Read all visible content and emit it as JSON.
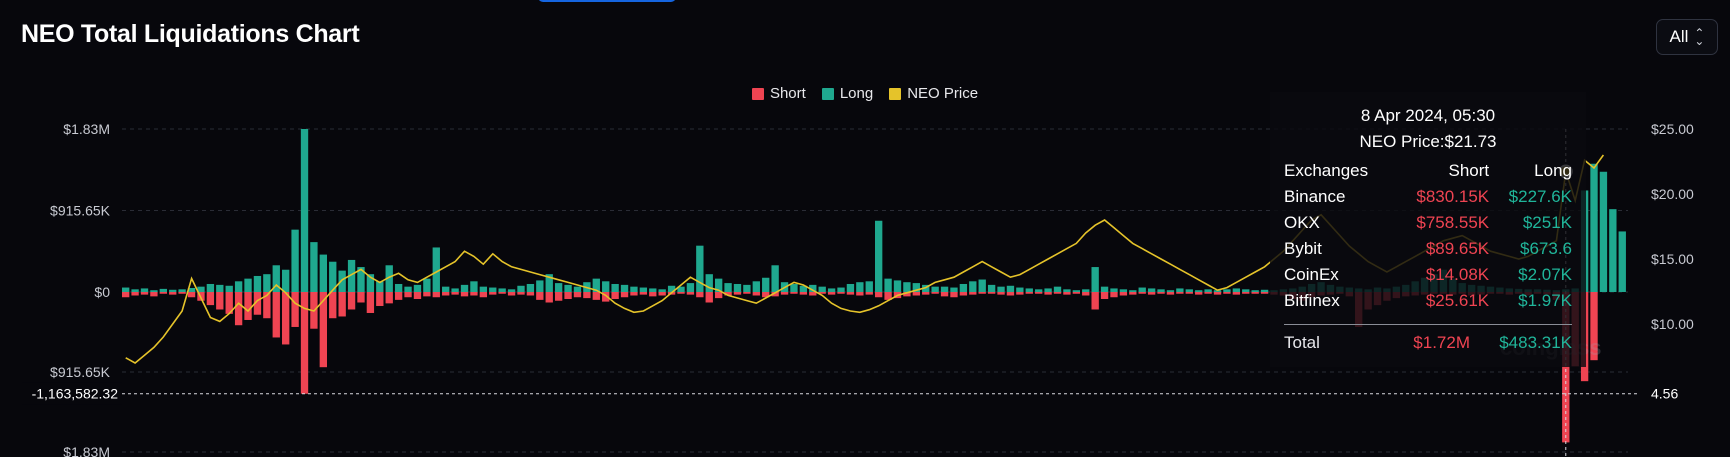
{
  "header": {
    "title": "NEO Total Liquidations Chart"
  },
  "range_select": {
    "value": "All"
  },
  "colors": {
    "short": "#ef4452",
    "long": "#1fa88f",
    "price": "#e5c32a",
    "bg": "#07070c"
  },
  "watermark": "coinglass",
  "chart_data": {
    "type": "bar",
    "legend": [
      "Short",
      "Long",
      "NEO Price"
    ],
    "legend_position": "top-center",
    "grid": true,
    "left_axis": {
      "ticks": [
        {
          "label": "$1.83M",
          "value": 1830000
        },
        {
          "label": "$915.65K",
          "value": 915650
        },
        {
          "label": "$0",
          "value": 0
        },
        {
          "label": "$915.65K",
          "value": -915650
        },
        {
          "label": "$1.83M",
          "value": -1830000
        }
      ],
      "range": [
        -2200000,
        2350000
      ]
    },
    "right_axis": {
      "ticks": [
        {
          "label": "$25.00",
          "value": 25
        },
        {
          "label": "$20.00",
          "value": 20
        },
        {
          "label": "$15.00",
          "value": 15
        },
        {
          "label": "$10.00",
          "value": 10
        }
      ],
      "range": [
        1.0,
        30.0
      ]
    },
    "crosshair": {
      "left_label": "-1,163,582.32",
      "right_label": "4.56",
      "value_left": -1163582.32,
      "value_right": 4.56
    },
    "series": [
      {
        "name": "Long",
        "values": [
          50000,
          30000,
          40000,
          20000,
          35000,
          25000,
          30000,
          45000,
          60000,
          90000,
          80000,
          70000,
          120000,
          150000,
          180000,
          200000,
          300000,
          250000,
          700000,
          1830000,
          560000,
          420000,
          340000,
          240000,
          360000,
          280000,
          200000,
          120000,
          300000,
          90000,
          60000,
          80000,
          150000,
          500000,
          60000,
          40000,
          80000,
          120000,
          60000,
          50000,
          40000,
          30000,
          70000,
          90000,
          130000,
          200000,
          100000,
          80000,
          60000,
          110000,
          150000,
          120000,
          90000,
          80000,
          60000,
          50000,
          40000,
          30000,
          70000,
          60000,
          100000,
          520000,
          200000,
          150000,
          100000,
          90000,
          80000,
          120000,
          160000,
          300000,
          110000,
          90000,
          70000,
          80000,
          60000,
          40000,
          50000,
          90000,
          110000,
          120000,
          800000,
          150000,
          130000,
          110000,
          100000,
          80000,
          60000,
          60000,
          50000,
          90000,
          120000,
          140000,
          80000,
          60000,
          70000,
          50000,
          40000,
          30000,
          40000,
          60000,
          30000,
          20000,
          30000,
          280000,
          60000,
          40000,
          30000,
          20000,
          50000,
          40000,
          30000,
          20000,
          40000,
          30000,
          20000,
          30000,
          20000,
          30000,
          40000,
          30000,
          20000,
          25000,
          20000,
          30000,
          40000,
          60000,
          90000,
          110000,
          80000,
          60000,
          50000,
          40000,
          30000,
          50000,
          40000,
          60000,
          80000,
          120000,
          160000,
          200000,
          250000,
          150000,
          100000,
          80000,
          70000,
          60000,
          50000,
          40000,
          35000,
          30000,
          30000,
          25000,
          20000,
          30000,
          40000,
          1140000,
          1440000,
          1350000,
          930000,
          680000
        ]
      },
      {
        "name": "Short",
        "values": [
          -60000,
          -40000,
          -30000,
          -50000,
          -20000,
          -30000,
          -20000,
          -60000,
          -100000,
          -150000,
          -200000,
          -250000,
          -380000,
          -320000,
          -260000,
          -300000,
          -520000,
          -600000,
          -400000,
          -1163582,
          -420000,
          -860000,
          -300000,
          -280000,
          -200000,
          -120000,
          -240000,
          -160000,
          -130000,
          -90000,
          -60000,
          -80000,
          -50000,
          -60000,
          -40000,
          -30000,
          -50000,
          -40000,
          -60000,
          -30000,
          -20000,
          -40000,
          -30000,
          -40000,
          -90000,
          -120000,
          -100000,
          -80000,
          -60000,
          -70000,
          -90000,
          -110000,
          -80000,
          -60000,
          -40000,
          -30000,
          -50000,
          -40000,
          -30000,
          -20000,
          -30000,
          -60000,
          -120000,
          -70000,
          -40000,
          -30000,
          -20000,
          -40000,
          -60000,
          -50000,
          -30000,
          -20000,
          -30000,
          -40000,
          -20000,
          -30000,
          -20000,
          -30000,
          -40000,
          -30000,
          -60000,
          -90000,
          -70000,
          -50000,
          -40000,
          -30000,
          -20000,
          -50000,
          -60000,
          -40000,
          -30000,
          -20000,
          -20000,
          -30000,
          -40000,
          -30000,
          -20000,
          -20000,
          -30000,
          -20000,
          -30000,
          -20000,
          -40000,
          -200000,
          -80000,
          -60000,
          -40000,
          -30000,
          -20000,
          -30000,
          -20000,
          -30000,
          -20000,
          -20000,
          -30000,
          -20000,
          -30000,
          -20000,
          -30000,
          -20000,
          -20000,
          -20000,
          -30000,
          -40000,
          -80000,
          -100000,
          -60000,
          -40000,
          -30000,
          -20000,
          -50000,
          -400000,
          -200000,
          -150000,
          -100000,
          -70000,
          -50000,
          -40000,
          -30000,
          -20000,
          -20000,
          -30000,
          -20000,
          -40000,
          -30000,
          -20000,
          -20000,
          -30000,
          -20000,
          -40000,
          -20000,
          -30000,
          -90000,
          -1720000,
          -850000,
          -1020000,
          -780000
        ]
      },
      {
        "name": "NEO Price",
        "values": [
          7.4,
          7.0,
          7.6,
          8.2,
          9.0,
          10.0,
          11.0,
          13.5,
          12.0,
          10.5,
          10.2,
          10.8,
          11.6,
          11.0,
          11.8,
          12.2,
          13.0,
          12.4,
          11.6,
          11.2,
          11.0,
          11.8,
          12.6,
          13.4,
          13.8,
          14.2,
          13.6,
          13.2,
          13.6,
          13.9,
          13.4,
          13.2,
          13.6,
          14.0,
          14.4,
          14.8,
          15.6,
          15.2,
          14.6,
          15.4,
          14.8,
          14.4,
          14.2,
          14.0,
          13.8,
          13.6,
          13.4,
          13.2,
          13.0,
          12.8,
          12.6,
          12.2,
          11.6,
          11.2,
          10.9,
          11.0,
          11.4,
          11.8,
          12.4,
          13.0,
          13.6,
          13.2,
          12.8,
          12.6,
          12.2,
          12.0,
          11.8,
          11.6,
          12.0,
          12.4,
          12.8,
          13.2,
          13.0,
          12.6,
          12.2,
          11.6,
          11.2,
          11.0,
          10.9,
          11.1,
          11.4,
          11.8,
          12.2,
          12.4,
          12.6,
          12.8,
          13.2,
          13.4,
          13.6,
          14.0,
          14.4,
          14.8,
          14.4,
          14.0,
          13.6,
          13.8,
          14.2,
          14.6,
          15.0,
          15.4,
          15.8,
          16.2,
          17.0,
          17.6,
          18.0,
          17.4,
          16.8,
          16.2,
          15.8,
          15.4,
          15.0,
          14.6,
          14.2,
          13.8,
          13.4,
          13.0,
          12.6,
          12.8,
          13.2,
          13.6,
          14.0,
          14.4,
          15.0,
          15.6,
          16.4,
          17.2,
          18.0,
          18.4,
          17.6,
          16.8,
          16.0,
          15.4,
          14.8,
          14.4,
          14.0,
          14.4,
          14.8,
          15.2,
          15.6,
          16.0,
          16.4,
          16.6,
          16.8,
          16.4,
          16.0,
          15.6,
          15.4,
          15.2,
          15.0,
          15.2,
          15.6,
          16.0,
          16.4,
          21.73,
          19.5,
          22.6,
          22.0,
          23.0
        ]
      }
    ],
    "tooltip": {
      "date": "8 Apr 2024, 05:30",
      "price_line": "NEO Price:$21.73",
      "columns": [
        "Exchanges",
        "Short",
        "Long"
      ],
      "rows": [
        {
          "exchange": "Binance",
          "short": "$830.15K",
          "long": "$227.6K"
        },
        {
          "exchange": "OKX",
          "short": "$758.55K",
          "long": "$251K"
        },
        {
          "exchange": "Bybit",
          "short": "$89.65K",
          "long": "$673.6"
        },
        {
          "exchange": "CoinEx",
          "short": "$14.08K",
          "long": "$2.07K"
        },
        {
          "exchange": "Bitfinex",
          "short": "$25.61K",
          "long": "$1.97K"
        }
      ],
      "total": {
        "label": "Total",
        "short": "$1.72M",
        "long": "$483.31K"
      }
    }
  }
}
